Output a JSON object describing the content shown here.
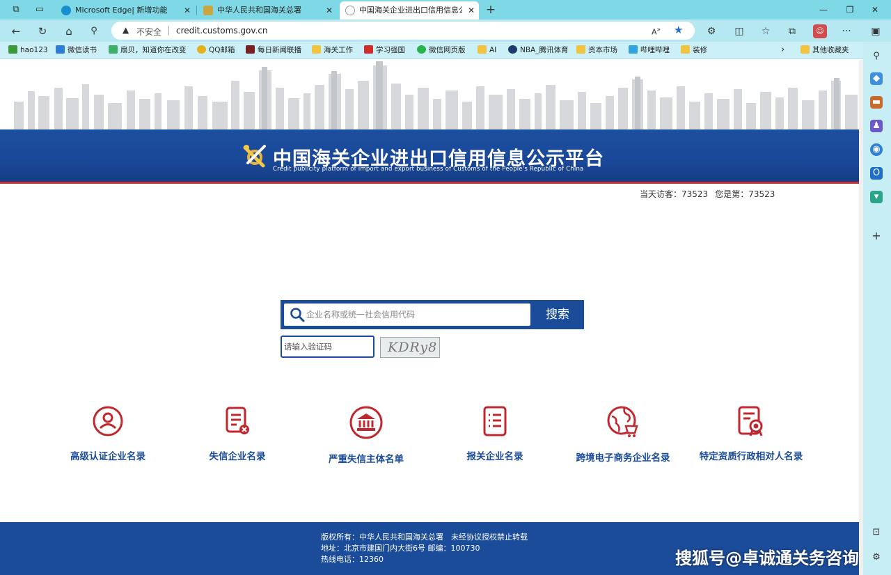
{
  "browser": {
    "tabs": [
      {
        "label": "Microsoft Edge| 新增功能",
        "active": false
      },
      {
        "label": "中华人民共和国海关总署",
        "active": false
      },
      {
        "label": "中国海关企业进出口信用信息公示平台",
        "active": true
      }
    ],
    "address": {
      "security_label": "不安全",
      "url": "credit.customs.gov.cn"
    },
    "bookmarks": [
      {
        "label": "hao123"
      },
      {
        "label": "微信读书"
      },
      {
        "label": "扇贝，知道你在改变"
      },
      {
        "label": "QQ邮箱"
      },
      {
        "label": "每日新闻联播"
      },
      {
        "label": "海关工作"
      },
      {
        "label": "学习强国"
      },
      {
        "label": "微信网页版"
      },
      {
        "label": "AI"
      },
      {
        "label": "NBA_腾讯体育"
      },
      {
        "label": "资本市场"
      },
      {
        "label": "哔哩哔哩"
      },
      {
        "label": "装修"
      },
      {
        "label": "其他收藏夹"
      }
    ]
  },
  "site": {
    "title": "中国海关企业进出口信用信息公示平台",
    "subtitle": "Credit publicity platform of import and export business of Customs of the People's Republic of China",
    "visitors": {
      "today": "当天访客：73523",
      "rank": "您是第：73523"
    },
    "search": {
      "placeholder": "企业名称或统一社会信用代码",
      "button": "搜索",
      "captcha_placeholder": "请输入验证码",
      "captcha_text": "KDRy8"
    },
    "categories": [
      {
        "label": "高级认证企业名录",
        "icon": "person-icon"
      },
      {
        "label": "失信企业名录",
        "icon": "document-x-icon"
      },
      {
        "label": "严重失信主体名单",
        "icon": "bank-icon"
      },
      {
        "label": "报关企业名录",
        "icon": "list-icon"
      },
      {
        "label": "跨境电子商务企业名录",
        "icon": "globe-cart-icon"
      },
      {
        "label": "特定资质行政相对人名录",
        "icon": "certificate-icon"
      }
    ],
    "footer": {
      "copyright": "版权所有：中华人民共和国海关总署　未经协议授权禁止转载",
      "address": "地址：北京市建国门内大街6号 邮编：100730",
      "hotline": "热线电话：12360"
    },
    "watermark": "搜狐号@卓诚通关务咨询"
  },
  "colors": {
    "brand_blue": "#1b4c9a",
    "category_red": "#c0282f",
    "browser_chrome": "#7ed8e6"
  }
}
